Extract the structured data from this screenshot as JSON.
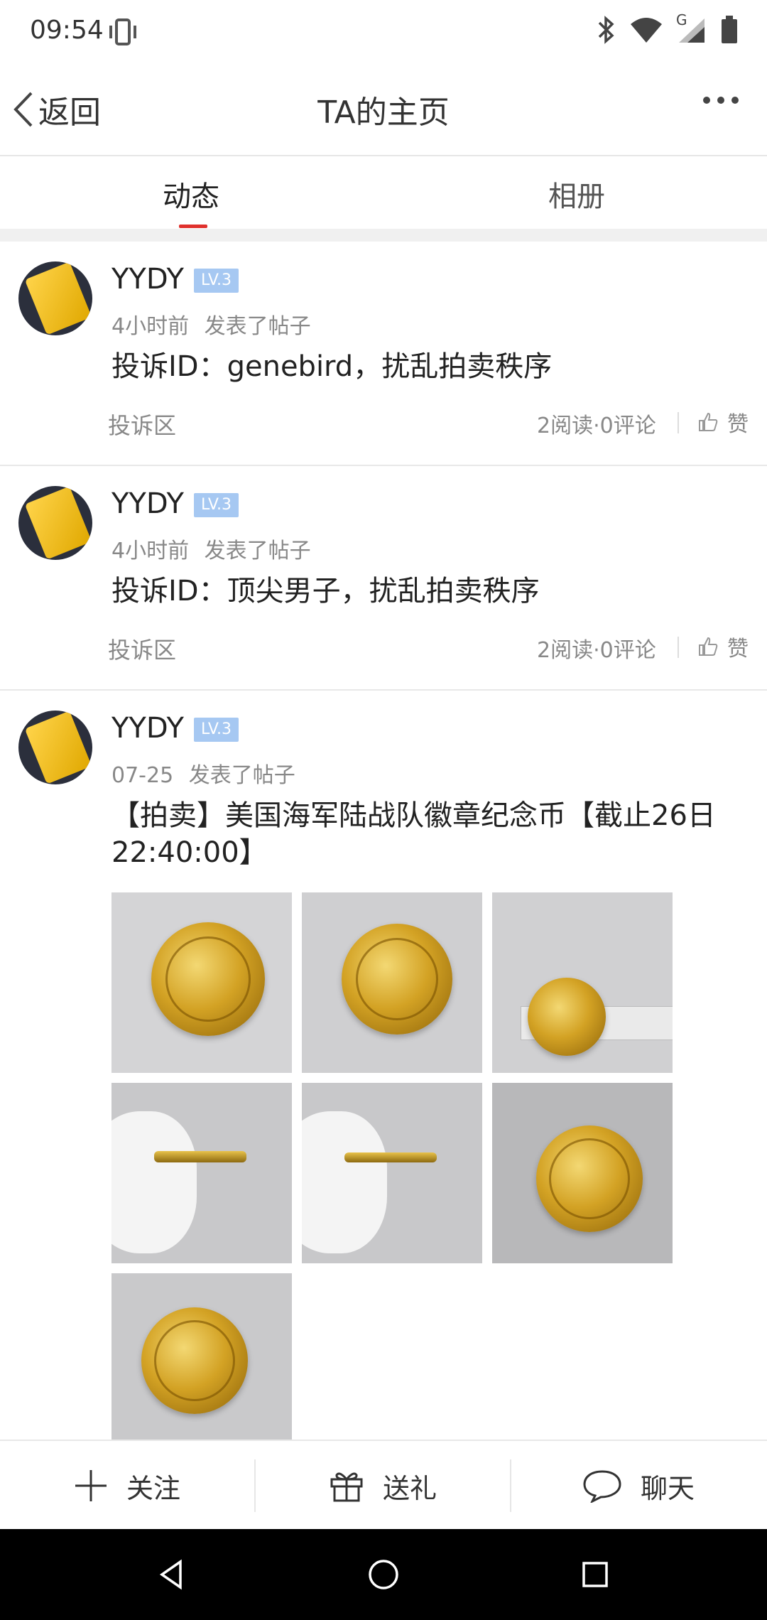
{
  "status_bar": {
    "time": "09:54",
    "network_label": "G"
  },
  "nav": {
    "back_label": "返回",
    "title": "TA的主页"
  },
  "tabs": [
    {
      "label": "动态",
      "active": true
    },
    {
      "label": "相册",
      "active": false
    }
  ],
  "posts": [
    {
      "username": "YYDY",
      "level": "LV.3",
      "time": "4小时前",
      "action": "发表了帖子",
      "title": "投诉ID：genebird，扰乱拍卖秩序",
      "category": "投诉区",
      "stats": "2阅读·0评论",
      "like_label": "赞"
    },
    {
      "username": "YYDY",
      "level": "LV.3",
      "time": "4小时前",
      "action": "发表了帖子",
      "title": "投诉ID：顶尖男子，扰乱拍卖秩序",
      "category": "投诉区",
      "stats": "2阅读·0评论",
      "like_label": "赞"
    },
    {
      "username": "YYDY",
      "level": "LV.3",
      "time": "07-25",
      "action": "发表了帖子",
      "title_line1": "【拍卖】美国海军陆战队徽章纪念币【截止26日",
      "title_line2": "22:40:00】",
      "photo_count": 7
    }
  ],
  "bottom_actions": [
    {
      "label": "关注",
      "icon": "plus-icon"
    },
    {
      "label": "送礼",
      "icon": "gift-icon"
    },
    {
      "label": "聊天",
      "icon": "chat-bubble-icon"
    }
  ],
  "colors": {
    "accent_red": "#e0312d",
    "level_badge": "#a6c8f2",
    "secondary_text": "#888888"
  }
}
